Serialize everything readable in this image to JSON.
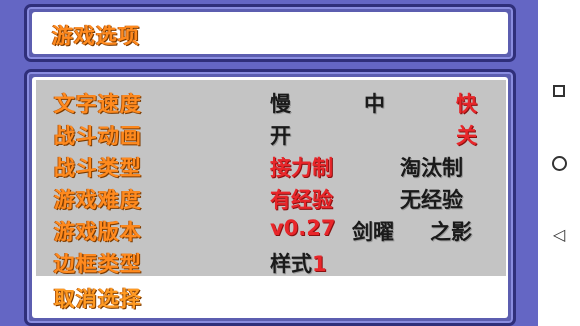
{
  "header": {
    "title": "游戏选项"
  },
  "menu": {
    "rows": [
      {
        "label": "文字速度",
        "options": [
          "慢",
          "中",
          "快"
        ],
        "selected": 2
      },
      {
        "label": "战斗动画",
        "options": [
          "开",
          "关"
        ],
        "selected": 1
      },
      {
        "label": "战斗类型",
        "options": [
          "接力制",
          "淘汰制"
        ],
        "selected": 0
      },
      {
        "label": "游戏难度",
        "options": [
          "有经验",
          "无经验"
        ],
        "selected": 0
      },
      {
        "label": "游戏版本",
        "options": [
          "v0.27",
          "剑曜",
          "之影"
        ],
        "selected": 0
      },
      {
        "label": "边框类型",
        "options": [
          "样式1"
        ],
        "selected": -1,
        "selected_suffix": "1"
      }
    ],
    "cancel": "取消选择"
  },
  "navbar": {
    "icons": [
      "square-icon",
      "circle-icon",
      "back-triangle-icon"
    ]
  },
  "colors": {
    "accent_orange": "#ff8a1e",
    "selected_red": "#e8262a",
    "panel_blue": "#5c5eb0"
  }
}
